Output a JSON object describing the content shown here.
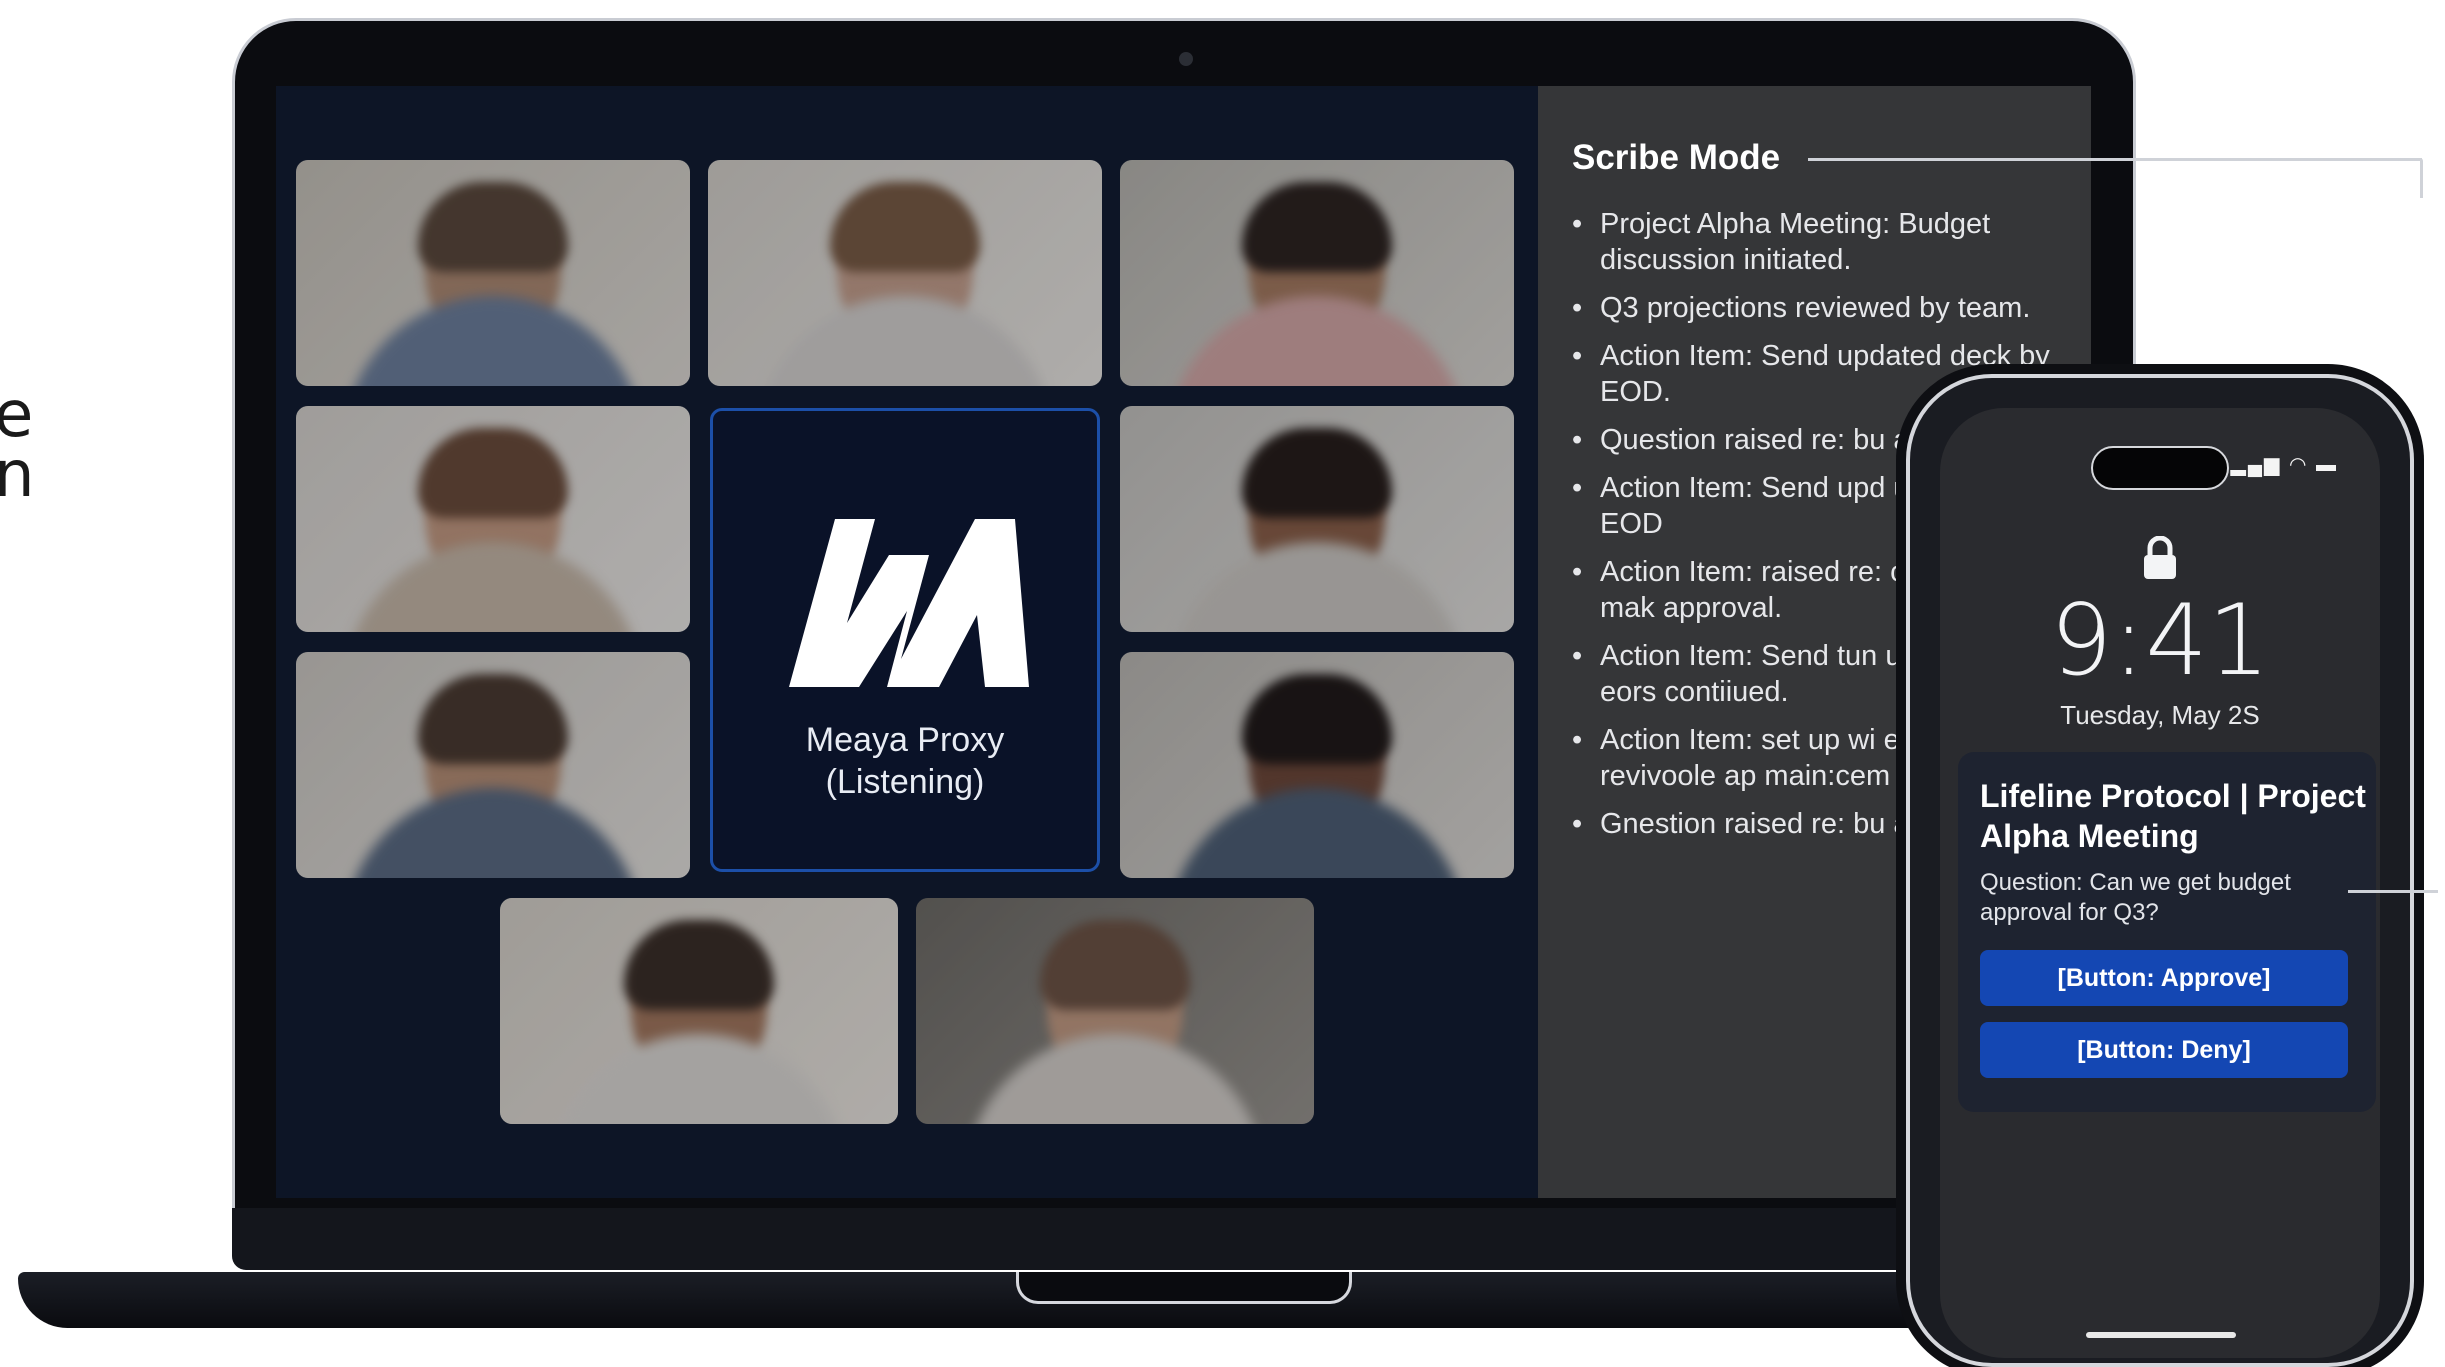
{
  "side_caption": {
    "line1": "e",
    "line2": "n"
  },
  "meeting": {
    "participants_count": 10,
    "proxy": {
      "name": "Meaya Proxy\n(Listening)",
      "logo": "meaya-logo"
    },
    "accent_color": "#1c4fa8"
  },
  "scribe": {
    "title": "Scribe Mode",
    "items": [
      "Project Alpha Meeting: Budget discussion initiated.",
      "Q3 projections reviewed by team.",
      "Action Item: Send updated deck by EOD.",
      "Question raised re: bu approval.",
      "Action Item: Send upd updated deck by EOD",
      "Action Item: raised re: contion raised to mak approval.",
      "Action Item: Send tun updated deck by eors contiiued.",
      "Action Item: set up wi eoavoote revivoole ap main:cem by EOD.",
      "Gnestion raised re: bu approval."
    ]
  },
  "phone": {
    "status_icons": "signal-wifi-battery",
    "lock_icon": "lock-icon",
    "time": "9:41",
    "date": "Tuesday, May 2S",
    "notification": {
      "title": "Lifeline Protocol | Project Alpha Meeting",
      "body": "Question: Can we get budget approval for Q3?",
      "approve_label": "[Button: Approve]",
      "deny_label": "[Button: Deny]",
      "button_color": "#1447b3"
    }
  }
}
